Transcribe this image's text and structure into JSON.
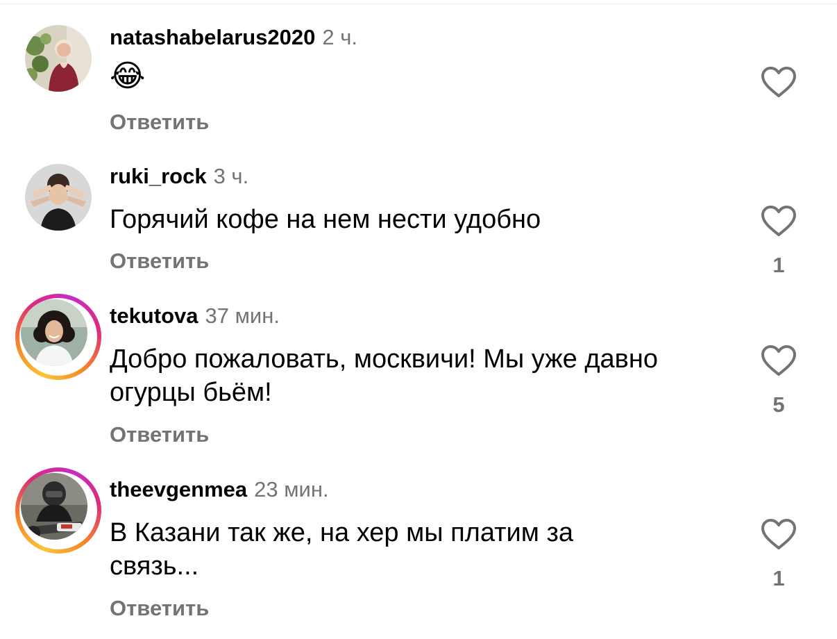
{
  "reply_label": "Ответить",
  "comments": [
    {
      "username": "natashabelarus2020",
      "time": "2 ч.",
      "text": "😂",
      "likes": "",
      "story_ring": false,
      "avatar_icon": "woman-with-plants-avatar"
    },
    {
      "username": "ruki_rock",
      "time": "3 ч.",
      "text": "Горячий кофе на нем нести удобно",
      "likes": "1",
      "story_ring": false,
      "avatar_icon": "hands-face-avatar"
    },
    {
      "username": "tekutova",
      "time": "37 мин.",
      "text": "Добро пожаловать, москвичи! Мы уже давно огурцы бьём!",
      "likes": "5",
      "story_ring": true,
      "avatar_icon": "smiling-woman-avatar"
    },
    {
      "username": "theevgenmea",
      "time": "23 мин.",
      "text": "В Казани так же, на хер мы платим за связь...",
      "likes": "1",
      "story_ring": true,
      "avatar_icon": "motorcyclist-avatar"
    }
  ],
  "colors": {
    "text": "#000000",
    "secondary": "#737373",
    "ring_start": "#f8c537",
    "ring_mid": "#dd2a7b",
    "ring_end": "#c72cc4"
  }
}
